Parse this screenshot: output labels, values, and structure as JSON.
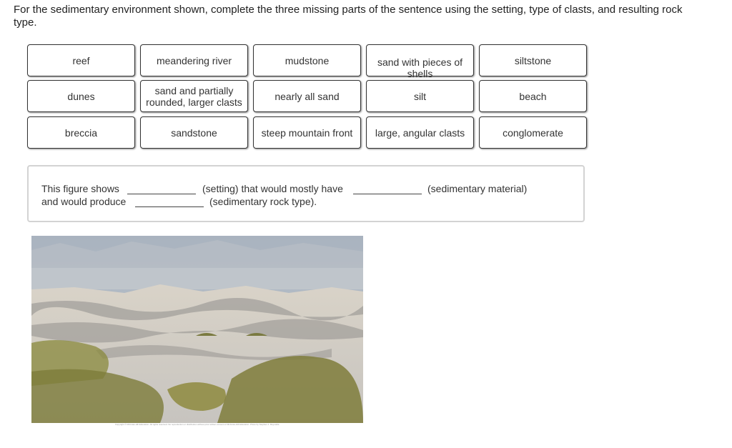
{
  "prompt": "For the sedimentary environment shown, complete the three missing parts of the sentence using the setting, type of clasts, and resulting rock type.",
  "tiles": [
    [
      "reef",
      "meandering river",
      "mudstone",
      "sand with pieces of shells",
      "siltstone"
    ],
    [
      "dunes",
      "sand and partially rounded, larger clasts",
      "nearly all sand",
      "silt",
      "beach"
    ],
    [
      "breccia",
      "sandstone",
      "steep mountain front",
      "large, angular clasts",
      "conglomerate"
    ]
  ],
  "sentence": {
    "part1": "This figure shows",
    "part2": "(setting) that would mostly have",
    "part3": "(sedimentary material)",
    "part4": "and would produce",
    "part5": "(sedimentary rock type).",
    "blanks": [
      "",
      "",
      ""
    ]
  },
  "figure": {
    "alt": "Sand dunes with desert shrubs in the foreground and hazy mountains in the background",
    "credit": "Copyright © McGraw-Hill Education. All rights reserved. No reproduction or distribution without prior written consent of McGraw-Hill Education. Photo by Stephen J. Reynolds."
  }
}
